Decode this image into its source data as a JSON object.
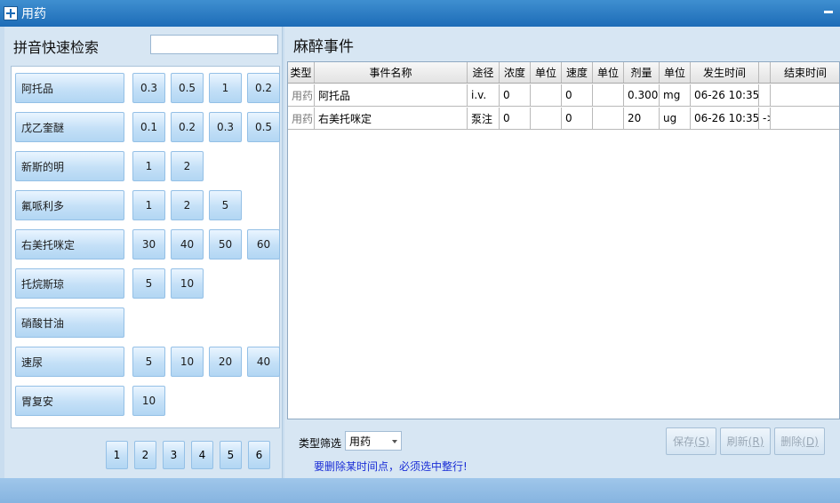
{
  "window": {
    "title": "用药"
  },
  "left": {
    "search_label": "拼音快速检索",
    "search_value": "",
    "drugs": [
      {
        "name": "阿托品",
        "doses": [
          "0.3",
          "0.5",
          "1",
          "0.2"
        ]
      },
      {
        "name": "戊乙奎醚",
        "doses": [
          "0.1",
          "0.2",
          "0.3",
          "0.5"
        ]
      },
      {
        "name": "新斯的明",
        "doses": [
          "1",
          "2"
        ]
      },
      {
        "name": "氟哌利多",
        "doses": [
          "1",
          "2",
          "5"
        ]
      },
      {
        "name": "右美托咪定",
        "doses": [
          "30",
          "40",
          "50",
          "60"
        ]
      },
      {
        "name": "托烷斯琼",
        "doses": [
          "5",
          "10"
        ]
      },
      {
        "name": "硝酸甘油",
        "doses": []
      },
      {
        "name": "速尿",
        "doses": [
          "5",
          "10",
          "20",
          "40"
        ]
      },
      {
        "name": "胃复安",
        "doses": [
          "10"
        ]
      }
    ],
    "pages": [
      "1",
      "2",
      "3",
      "4",
      "5",
      "6"
    ]
  },
  "right": {
    "title": "麻醉事件",
    "columns": [
      "类型",
      "事件名称",
      "途径",
      "浓度",
      "单位",
      "速度",
      "单位",
      "剂量",
      "单位",
      "发生时间",
      "",
      "结束时间"
    ],
    "rows": [
      [
        "用药",
        "阿托品",
        "i.v.",
        "0",
        "",
        "0",
        "",
        "0.300",
        "mg",
        "06-26 10:35",
        "",
        ""
      ],
      [
        "用药",
        "右美托咪定",
        "泵注",
        "0",
        "",
        "0",
        "",
        "20",
        "ug",
        "06-26 10:35",
        "->",
        ""
      ]
    ],
    "filter_label": "类型筛选",
    "filter_value": "用药",
    "warning": "要删除某时间点，必须选中整行!",
    "buttons": [
      {
        "text": "保存",
        "key": "(S)"
      },
      {
        "text": "刷新",
        "key": "(R)"
      },
      {
        "text": "删除",
        "key": "(D)"
      }
    ]
  }
}
